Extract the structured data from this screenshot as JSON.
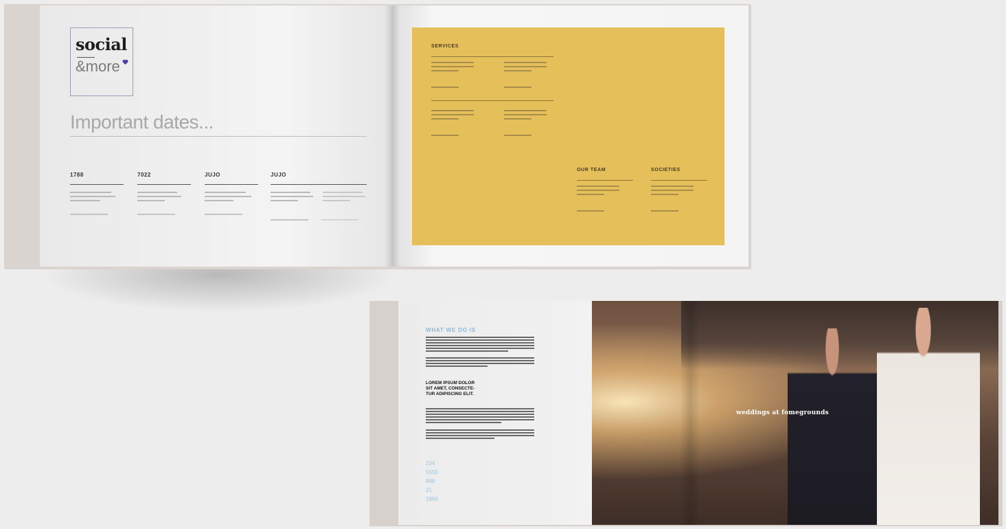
{
  "brand": {
    "name_top": "social",
    "name_bottom": "&more"
  },
  "left_page": {
    "title": "Important dates...",
    "columns": [
      {
        "heading": "1788"
      },
      {
        "heading": "7022"
      },
      {
        "heading": "JUJO"
      },
      {
        "heading": "JUJO"
      }
    ]
  },
  "right_page": {
    "sections": [
      {
        "label": "SERVICES"
      },
      {
        "label": "OUR TEAM"
      },
      {
        "label": "SOCIETIES"
      }
    ]
  },
  "bottom_spread": {
    "blue_title": "WHAT WE DO IS",
    "bold_text": [
      "LOREM IPSUM DOLOR",
      "SIT AMET, CONSECTE-",
      "TUR ADIPISCING ELIT."
    ],
    "blue_numbers": [
      "234",
      "5555",
      "888",
      "21",
      "1966"
    ],
    "photo_caption": "weddings at fomegrounds"
  },
  "colors": {
    "yellow": "#e5bf5a",
    "accent_blue": "#8fb8d6",
    "heart": "#4a3fa8"
  }
}
